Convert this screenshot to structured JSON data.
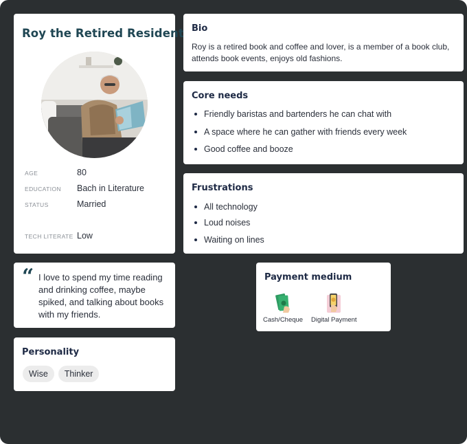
{
  "persona": {
    "name": "Roy  the Retired Resident",
    "details": [
      {
        "label": "AGE",
        "value": "80"
      },
      {
        "label": "EDUCATION",
        "value": "Bach in Literature"
      },
      {
        "label": "STATUS",
        "value": "Married"
      },
      {
        "label": "TECH LITERATE",
        "value": "Low"
      }
    ]
  },
  "quote": {
    "mark": "“",
    "text": "I love to spend my time reading and drinking coffee, maybe spiked, and talking about books with my friends."
  },
  "personality": {
    "title": "Personality",
    "tags": [
      "Wise",
      "Thinker"
    ]
  },
  "bio": {
    "title": "Bio",
    "text": "Roy is a retired book and coffee and lover, is a member of a book club, attends book events, enjoys old fashions."
  },
  "core_needs": {
    "title": "Core needs",
    "items": [
      "Friendly baristas and bartenders he can chat with",
      "A space where he can gather with friends every week",
      "Good coffee and booze"
    ]
  },
  "frustrations": {
    "title": "Frustrations",
    "items": [
      "All technology",
      "Loud noises",
      "Waiting on lines"
    ]
  },
  "payment": {
    "title": "Payment medium",
    "methods": [
      {
        "label": "Cash/Cheque",
        "icon": "cash-icon"
      },
      {
        "label": "Digital Payment",
        "icon": "digital-payment-icon"
      }
    ]
  },
  "colors": {
    "background": "#2b2f31",
    "card": "#ffffff",
    "name_accent": "#1f4653",
    "heading": "#1e2a45",
    "tag_bg": "#ececec"
  }
}
